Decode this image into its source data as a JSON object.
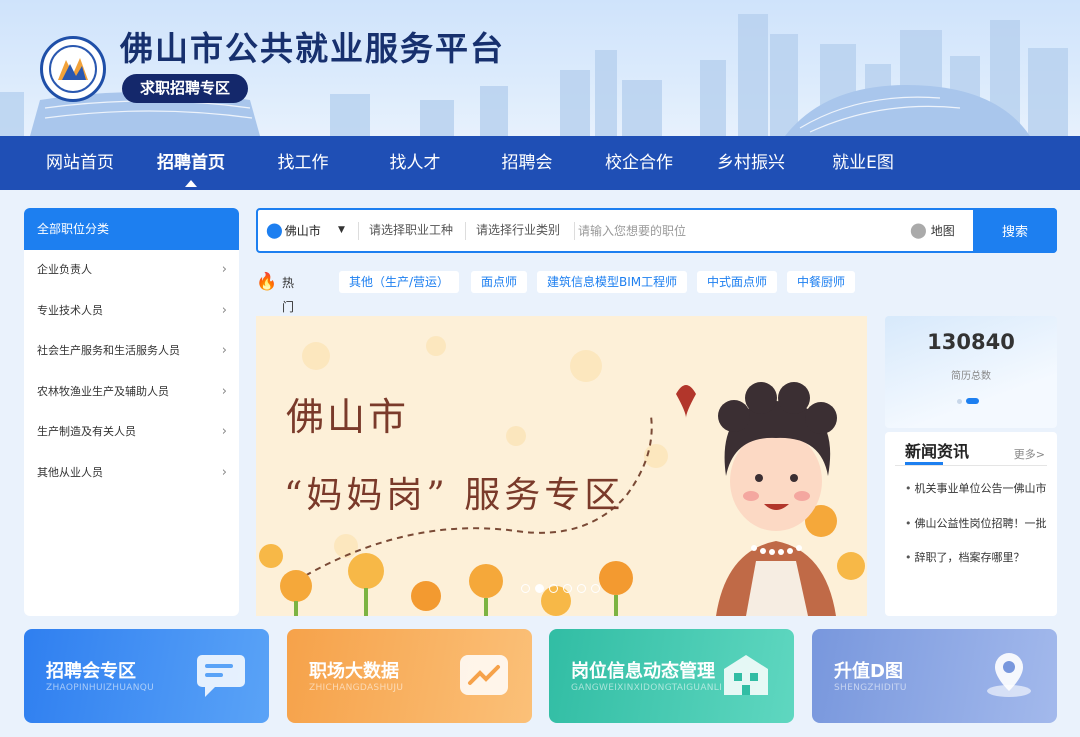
{
  "header": {
    "site_title": "佛山市公共就业服务平台",
    "zone_badge": "求职招聘专区"
  },
  "nav": {
    "items": [
      {
        "label": "网站首页"
      },
      {
        "label": "招聘首页",
        "active": true
      },
      {
        "label": "找工作"
      },
      {
        "label": "找人才"
      },
      {
        "label": "招聘会"
      },
      {
        "label": "校企合作"
      },
      {
        "label": "乡村振兴"
      },
      {
        "label": "就业E图"
      }
    ]
  },
  "categories": {
    "header": "全部职位分类",
    "items": [
      "企业负责人",
      "专业技术人员",
      "社会生产服务和生活服务人员",
      "农林牧渔业生产及辅助人员",
      "生产制造及有关人员",
      "其他从业人员"
    ]
  },
  "search": {
    "city": "佛山市",
    "occupation_placeholder": "请选择职业工种",
    "industry_placeholder": "请选择行业类别",
    "keyword_placeholder": "请输入您想要的职位",
    "map_label": "地图",
    "button_label": "搜索"
  },
  "hot": {
    "label": "热门岗位:",
    "tags": [
      "其他（生产/营运）",
      "面点师",
      "建筑信息模型BIM工程师",
      "中式面点师",
      "中餐厨师"
    ]
  },
  "banner": {
    "line1": "佛山市",
    "line2": "“妈妈岗” 服务专区",
    "slide_count": 6,
    "active_slide": 1
  },
  "stats": {
    "number": "130840",
    "label": "简历总数"
  },
  "news": {
    "title": "新闻资讯",
    "more": "更多>",
    "items": [
      "机关事业单位公告一佛山市",
      "佛山公益性岗位招聘！一批",
      "辞职了，档案存哪里？"
    ]
  },
  "cards": [
    {
      "title": "招聘会专区",
      "subtitle": "ZHAOPINHUIZHUANQU",
      "color": "#3d8cf0",
      "icon": "chat-card-icon"
    },
    {
      "title": "职场大数据",
      "subtitle": "ZHICHANGDASHUJU",
      "color": "#f7a94e",
      "icon": "trend-chart-icon"
    },
    {
      "title": "岗位信息动态管理",
      "subtitle": "GANGWEIXINXIDONGTAIGUANLI",
      "color": "#3cc2a9",
      "icon": "building-icon"
    },
    {
      "title": "升值D图",
      "subtitle": "SHENGZHIDITU",
      "color": "#7f9ede",
      "icon": "map-pin-icon"
    }
  ],
  "colors": {
    "nav_bg": "#1f4fb5",
    "accent": "#1d7ff0",
    "title_navy": "#17306e"
  }
}
